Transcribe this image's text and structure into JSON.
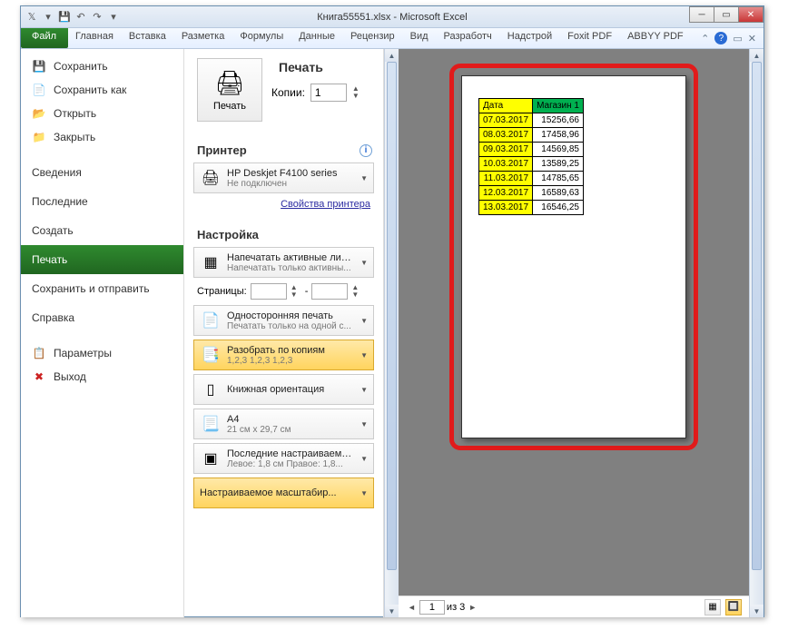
{
  "window": {
    "title": "Книга55551.xlsx - Microsoft Excel"
  },
  "ribbon": {
    "file": "Файл",
    "tabs": [
      "Главная",
      "Вставка",
      "Разметка",
      "Формулы",
      "Данные",
      "Рецензир",
      "Вид",
      "Разработч",
      "Надстрой",
      "Foxit PDF",
      "ABBYY PDF"
    ]
  },
  "backstage_left": {
    "save": "Сохранить",
    "save_as": "Сохранить как",
    "open": "Открыть",
    "close": "Закрыть",
    "info": "Сведения",
    "recent": "Последние",
    "new": "Создать",
    "print": "Печать",
    "save_send": "Сохранить и отправить",
    "help": "Справка",
    "options": "Параметры",
    "exit": "Выход"
  },
  "print": {
    "heading": "Печать",
    "button": "Печать",
    "copies_label": "Копии:",
    "copies_value": "1",
    "printer_heading": "Принтер",
    "printer_name": "HP Deskjet F4100 series",
    "printer_status": "Не подключен",
    "printer_props": "Свойства принтера",
    "settings_heading": "Настройка",
    "s_sheets_main": "Напечатать активные листы",
    "s_sheets_sub": "Напечатать только активны...",
    "pages_label": "Страницы:",
    "pages_dash": "-",
    "s_oneside_main": "Односторонняя печать",
    "s_oneside_sub": "Печатать только на одной с...",
    "s_collate_main": "Разобрать по копиям",
    "s_collate_sub": "1,2,3   1,2,3   1,2,3",
    "s_orient_main": "Книжная ориентация",
    "s_paper_main": "A4",
    "s_paper_sub": "21 см x 29,7 см",
    "s_margins_main": "Последние настраиваемые ...",
    "s_margins_sub": "Левое: 1,8 см   Правое: 1,8...",
    "s_scale_main": "Настраиваемое масштабир..."
  },
  "preview": {
    "page_input": "1",
    "page_of": "из 3",
    "nav_prev": "◄",
    "nav_next": "►"
  },
  "table": {
    "col_date": "Дата",
    "col_shop": "Магазин 1",
    "rows": [
      {
        "date": "07.03.2017",
        "val": "15256,66"
      },
      {
        "date": "08.03.2017",
        "val": "17458,96"
      },
      {
        "date": "09.03.2017",
        "val": "14569,85"
      },
      {
        "date": "10.03.2017",
        "val": "13589,25"
      },
      {
        "date": "11.03.2017",
        "val": "14785,65"
      },
      {
        "date": "12.03.2017",
        "val": "16589,63"
      },
      {
        "date": "13.03.2017",
        "val": "16546,25"
      }
    ]
  }
}
